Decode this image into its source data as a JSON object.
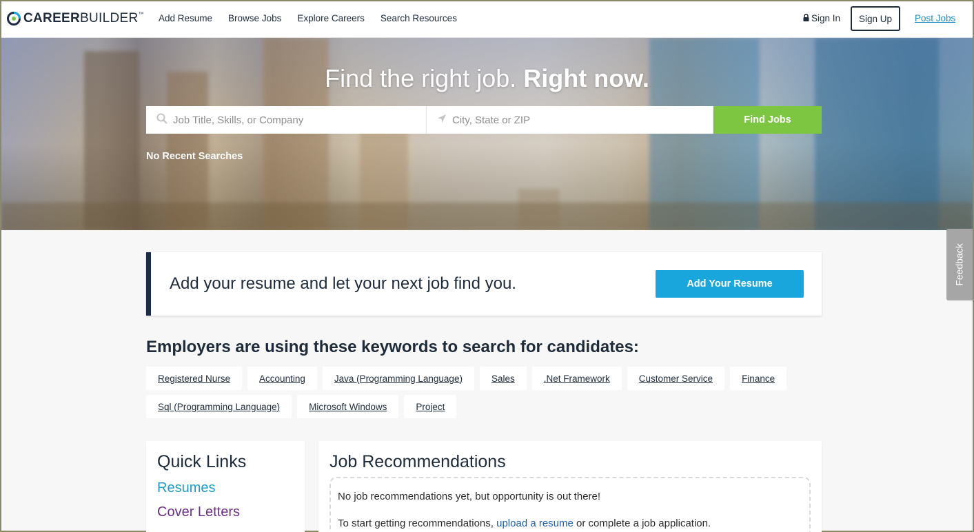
{
  "header": {
    "logo_bold": "CAREER",
    "logo_light": "BUILDER",
    "nav": [
      "Add Resume",
      "Browse Jobs",
      "Explore Careers",
      "Search Resources"
    ],
    "sign_in": "Sign In",
    "sign_up": "Sign Up",
    "post_jobs": "Post Jobs"
  },
  "hero": {
    "title_light": "Find the right job.",
    "title_bold": "Right now.",
    "job_placeholder": "Job Title, Skills, or Company",
    "location_placeholder": "City, State or ZIP",
    "find_jobs": "Find Jobs",
    "recent_searches": "No Recent Searches"
  },
  "feedback": "Feedback",
  "resume_banner": {
    "message": "Add your resume and let your next job find you.",
    "button": "Add Your Resume"
  },
  "keywords": {
    "title": "Employers are using these keywords to search for candidates:",
    "items": [
      "Registered Nurse",
      "Accounting",
      "Java (Programming Language)",
      "Sales",
      ".Net Framework",
      "Customer Service",
      "Finance",
      "Sql (Programming Language)",
      "Microsoft Windows",
      "Project"
    ]
  },
  "quick_links": {
    "title": "Quick Links",
    "items": [
      "Resumes",
      "Cover Letters"
    ]
  },
  "job_recommendations": {
    "title": "Job Recommendations",
    "line1": "No job recommendations yet, but opportunity is out there!",
    "line2_prefix": "To start getting recommendations,",
    "line2_link": "upload a resume",
    "line2_suffix": "or complete a job application."
  },
  "colors": {
    "accent_green": "#7dc642",
    "accent_blue": "#19a6dc",
    "link_blue": "#1f8ec7",
    "navy": "#1d2b46",
    "visited_purple": "#6b2f88"
  }
}
